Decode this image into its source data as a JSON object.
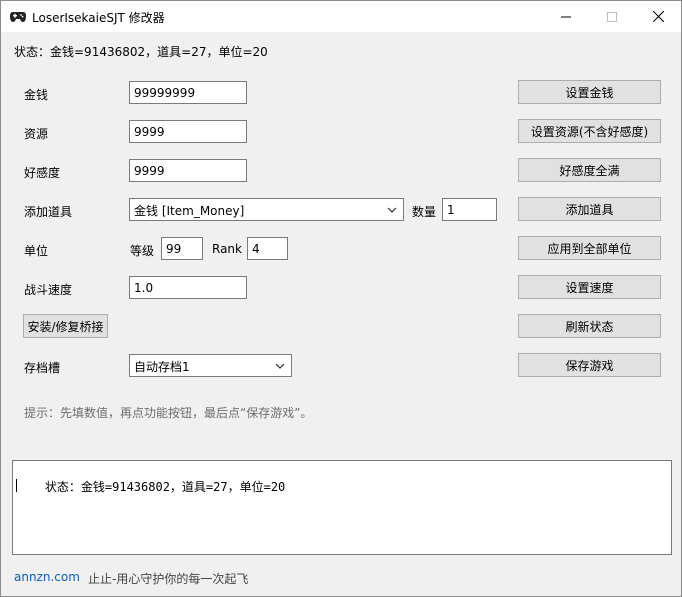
{
  "window": {
    "title": "LoserIsekaieSJT 修改器",
    "controls": {
      "minimize": "—",
      "maximize": "☐",
      "close": "✕"
    }
  },
  "status_line": "状态：金钱=91436802，道具=27，单位=20",
  "form": {
    "money": {
      "label": "金钱",
      "value": "99999999",
      "button": "设置金钱"
    },
    "resource": {
      "label": "资源",
      "value": "9999",
      "button": "设置资源(不含好感度)"
    },
    "affinity": {
      "label": "好感度",
      "value": "9999",
      "button": "好感度全满"
    },
    "item": {
      "label": "添加道具",
      "selected": "金钱 [Item_Money]",
      "qty_label": "数量",
      "qty_value": "1",
      "button": "添加道具"
    },
    "unit": {
      "label": "单位",
      "level_label": "等级",
      "level_value": "99",
      "rank_label": "Rank",
      "rank_value": "4",
      "button": "应用到全部单位"
    },
    "speed": {
      "label": "战斗速度",
      "value": "1.0",
      "button": "设置速度"
    },
    "bridge": {
      "button": "安装/修复桥接",
      "refresh_button": "刷新状态"
    },
    "save": {
      "label": "存档槽",
      "selected": "自动存档1",
      "button": "保存游戏"
    }
  },
  "hint": "提示：先填数值，再点功能按钮，最后点“保存游戏”。",
  "log_text": "状态：金钱=91436802，道具=27，单位=20",
  "footer": {
    "link": "annzn.com",
    "slogan": "止止-用心守护你的每一次起飞"
  },
  "icons": {
    "app": "gamepad-icon",
    "dropdown": "chevron-down-icon"
  }
}
